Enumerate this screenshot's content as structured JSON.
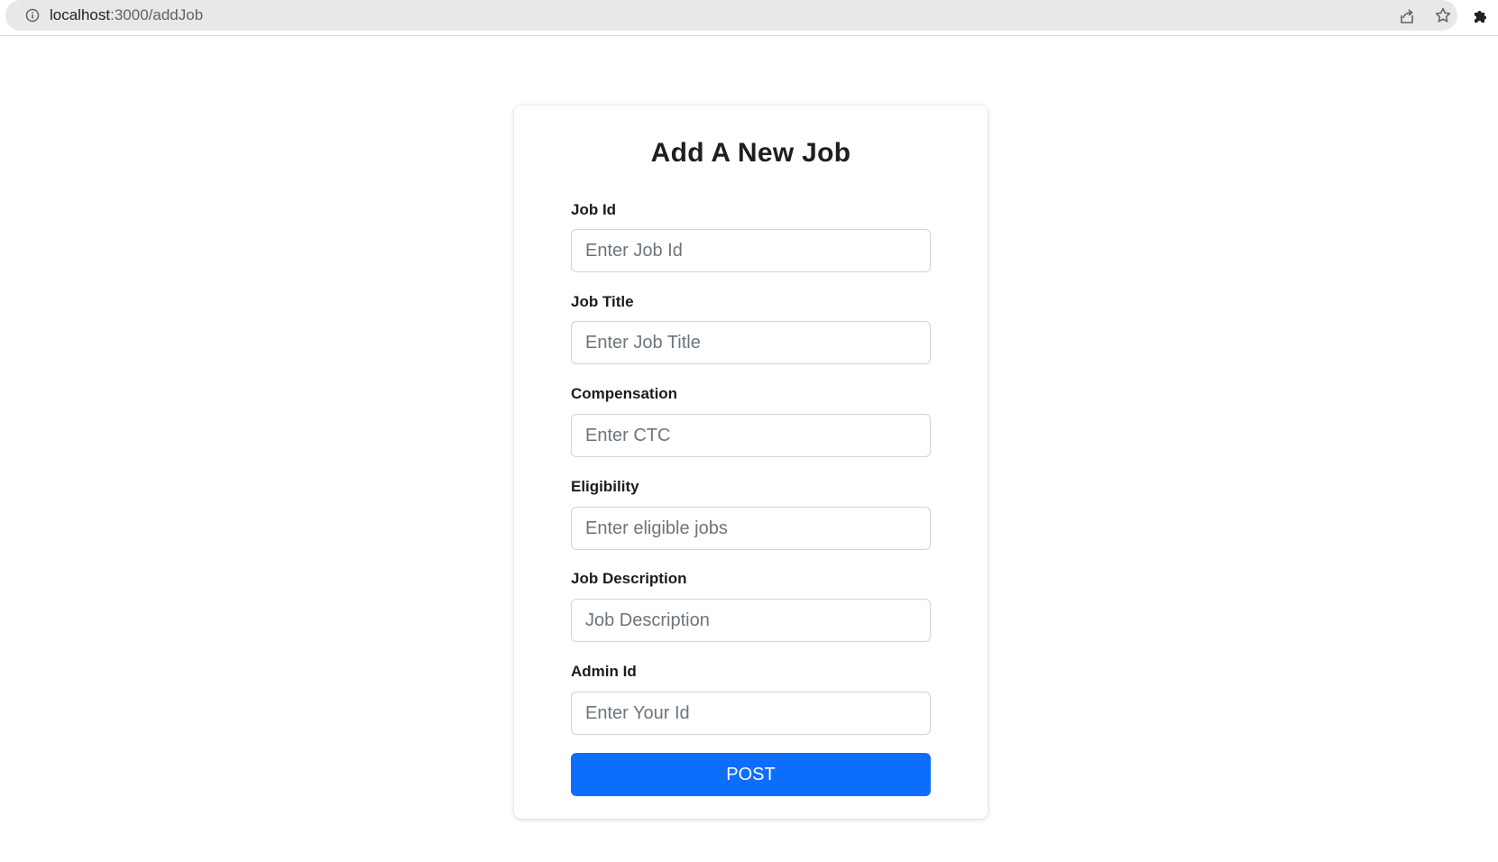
{
  "browser": {
    "url_host": "localhost",
    "url_path": ":3000/addJob"
  },
  "form": {
    "title": "Add A New Job",
    "fields": [
      {
        "label": "Job Id",
        "placeholder": "Enter Job Id",
        "value": ""
      },
      {
        "label": "Job Title",
        "placeholder": "Enter Job Title",
        "value": ""
      },
      {
        "label": "Compensation",
        "placeholder": "Enter CTC",
        "value": ""
      },
      {
        "label": "Eligibility",
        "placeholder": "Enter eligible jobs",
        "value": ""
      },
      {
        "label": "Job Description",
        "placeholder": "Job Description",
        "value": ""
      },
      {
        "label": "Admin Id",
        "placeholder": "Enter Your Id",
        "value": ""
      }
    ],
    "submit_label": "POST"
  },
  "colors": {
    "accent": "#0d6efd",
    "omnibox": "#e8e8e8",
    "input_border": "#ced4da"
  },
  "icons": {
    "site_info": "info-icon",
    "share": "share-icon",
    "bookmark": "star-icon",
    "extensions": "puzzle-icon"
  }
}
